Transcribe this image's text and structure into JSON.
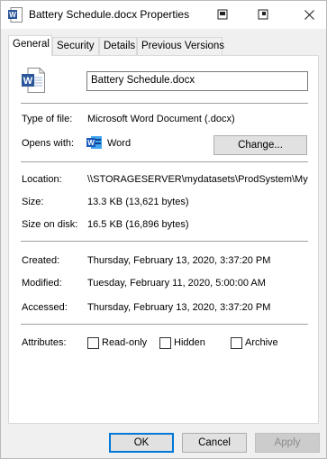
{
  "window": {
    "title": "Battery Schedule.docx Properties"
  },
  "tabs": [
    {
      "label": "General"
    },
    {
      "label": "Security"
    },
    {
      "label": "Details"
    },
    {
      "label": "Previous Versions"
    }
  ],
  "general": {
    "file_name": "Battery Schedule.docx",
    "type_label": "Type of file:",
    "type_value": "Microsoft Word Document (.docx)",
    "opens_label": "Opens with:",
    "opens_value": "Word",
    "change_button": "Change...",
    "location_label": "Location:",
    "location_value": "\\\\STORAGESERVER\\mydatasets\\ProdSystem\\My",
    "size_label": "Size:",
    "size_value": "13.3 KB (13,621 bytes)",
    "size_on_disk_label": "Size on disk:",
    "size_on_disk_value": "16.5 KB (16,896 bytes)",
    "created_label": "Created:",
    "created_value": "Thursday, February 13, 2020, 3:37:20 PM",
    "modified_label": "Modified:",
    "modified_value": "Tuesday, February 11, 2020, 5:00:00 AM",
    "accessed_label": "Accessed:",
    "accessed_value": "Thursday, February 13, 2020, 3:37:20 PM",
    "attributes_label": "Attributes:",
    "readonly_label": "Read-only",
    "hidden_label": "Hidden",
    "archive_label": "Archive",
    "readonly_checked": false,
    "hidden_checked": false,
    "archive_checked": false
  },
  "footer": {
    "ok": "OK",
    "cancel": "Cancel",
    "apply": "Apply"
  },
  "icons": {
    "word_blue": "#2b579a",
    "accent": "#0078d7"
  }
}
